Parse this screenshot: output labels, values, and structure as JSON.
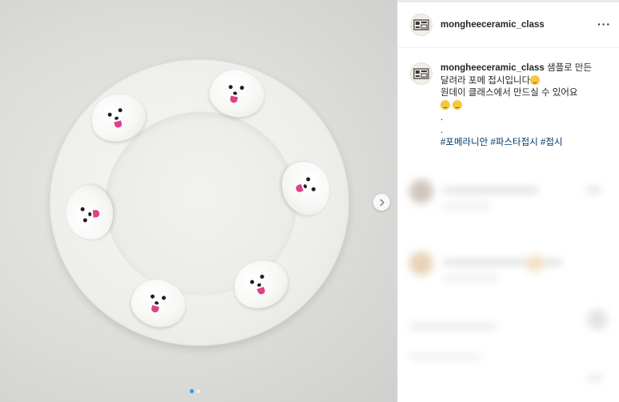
{
  "post": {
    "username": "mongheeceramic_class",
    "more_icon": "more-horizontal-icon",
    "caption": {
      "line1": "샘플로 만든",
      "line2": "달려라 포메 접시입니다",
      "line3": "원데이 클래스에서 만드실 수 있어요",
      "line5": ".",
      "line6": ".",
      "hashtags": [
        "#포메라니안",
        "#파스타접시",
        "#접시"
      ]
    }
  },
  "carousel": {
    "next_icon": "chevron-right-icon",
    "slide_count": 2,
    "active_slide": 1,
    "active_color": "#2f9bf0"
  },
  "colors": {
    "hashtag": "#00376b",
    "text": "#262626"
  }
}
